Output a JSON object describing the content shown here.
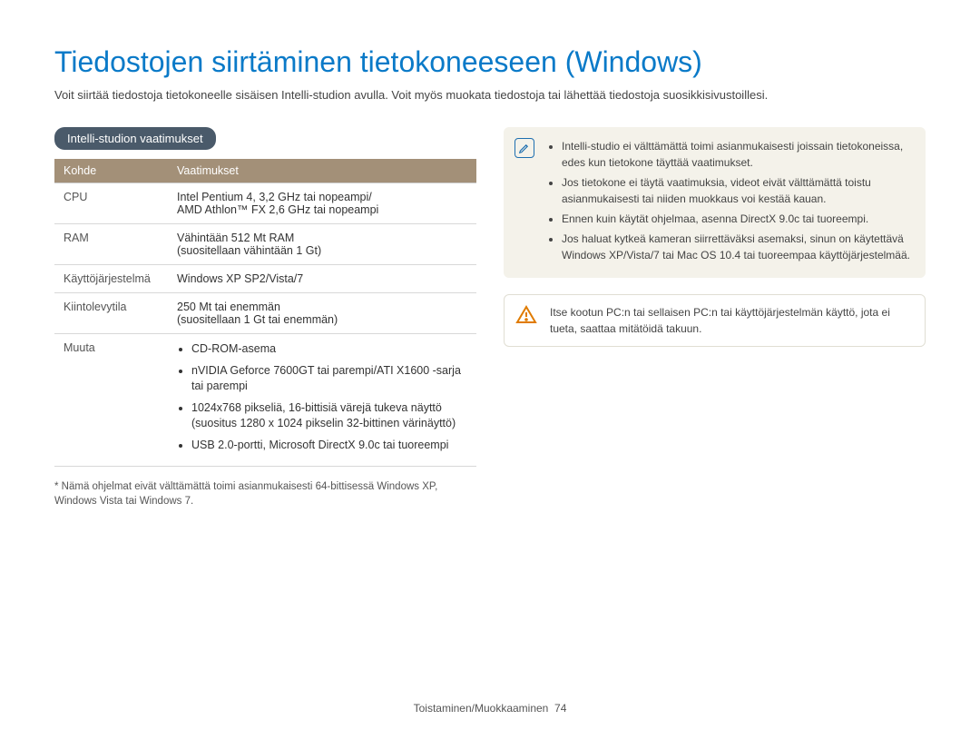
{
  "title": "Tiedostojen siirtäminen tietokoneeseen (Windows)",
  "intro": "Voit siirtää tiedostoja tietokoneelle sisäisen Intelli-studion avulla. Voit myös muokata tiedostoja tai lähettää tiedostoja suosikkisivustoillesi.",
  "section_title": "Intelli-studion vaatimukset",
  "table": {
    "header_item": "Kohde",
    "header_req": "Vaatimukset",
    "cpu_label": "CPU",
    "cpu_line1": "Intel Pentium 4, 3,2 GHz tai nopeampi/",
    "cpu_line2": "AMD Athlon™ FX 2,6 GHz tai nopeampi",
    "ram_label": "RAM",
    "ram_line1": "Vähintään 512 Mt RAM",
    "ram_line2": "(suositellaan vähintään 1 Gt)",
    "os_label": "Käyttöjärjestelmä",
    "os_value": "Windows XP SP2/Vista/7",
    "hdd_label": "Kiintolevytila",
    "hdd_line1": "250 Mt tai enemmän",
    "hdd_line2": "(suositellaan 1 Gt tai enemmän)",
    "other_label": "Muuta",
    "other_items": {
      "i1": "CD-ROM-asema",
      "i2": "nVIDIA Geforce 7600GT tai parempi/ATI X1600 -sarja tai parempi",
      "i3": "1024x768 pikseliä, 16-bittisiä värejä tukeva näyttö (suositus 1280 x 1024 pikselin 32-bittinen värinäyttö)",
      "i4": "USB 2.0-portti, Microsoft DirectX 9.0c tai tuoreempi"
    }
  },
  "footnote": "* Nämä ohjelmat eivät välttämättä toimi asianmukaisesti 64-bittisessä Windows XP, Windows Vista tai Windows 7.",
  "note": {
    "i1": "Intelli-studio ei välttämättä toimi asianmukaisesti joissain tietokoneissa, edes kun tietokone täyttää vaatimukset.",
    "i2": "Jos tietokone ei täytä vaatimuksia, videot eivät välttämättä toistu asianmukaisesti tai niiden muokkaus voi kestää kauan.",
    "i3": "Ennen kuin käytät ohjelmaa, asenna DirectX 9.0c tai tuoreempi.",
    "i4": "Jos haluat kytkeä kameran siirrettäväksi asemaksi, sinun on käytettävä Windows XP/Vista/7 tai Mac OS 10.4 tai tuoreempaa käyttöjärjestelmää."
  },
  "warning": "Itse kootun PC:n tai sellaisen PC:n tai käyttöjärjestelmän käyttö, jota ei tueta, saattaa mitätöidä takuun.",
  "footer": {
    "text": "Toistaminen/Muokkaaminen",
    "page": "74"
  }
}
